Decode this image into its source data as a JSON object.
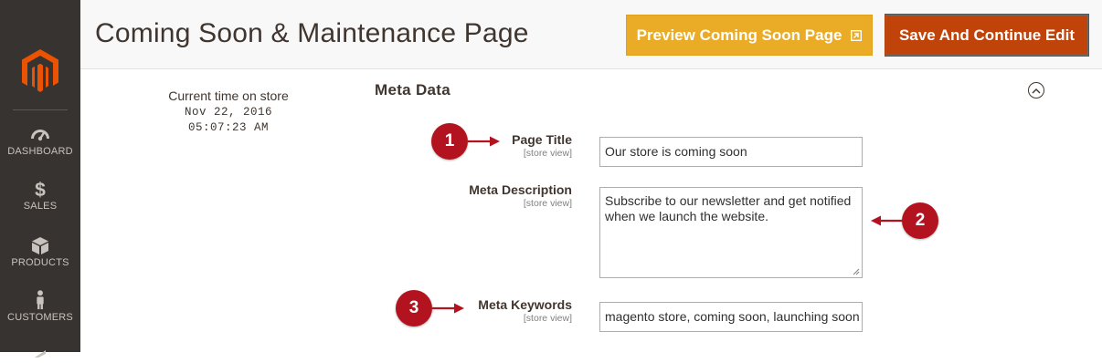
{
  "sidebar": {
    "items": [
      {
        "label": "DASHBOARD",
        "icon": "dashboard-icon"
      },
      {
        "label": "SALES",
        "icon": "dollar-icon"
      },
      {
        "label": "PRODUCTS",
        "icon": "box-icon"
      },
      {
        "label": "CUSTOMERS",
        "icon": "person-icon"
      }
    ],
    "colors": {
      "background": "#373330",
      "logo": "#eb5202",
      "text": "#c9c3bd"
    }
  },
  "header": {
    "title": "Coming Soon & Maintenance Page",
    "preview_button": "Preview Coming Soon Page",
    "save_button": "Save And Continue Edit",
    "colors": {
      "preview": "#eaac26",
      "save": "#c0440a"
    }
  },
  "store_time": {
    "label": "Current time on store",
    "date": "Nov 22, 2016",
    "time": "05:07:23 AM"
  },
  "section": {
    "title": "Meta Data",
    "fields": [
      {
        "label": "Page Title",
        "scope": "[store view]",
        "value": "Our store is coming soon"
      },
      {
        "label": "Meta Description",
        "scope": "[store view]",
        "value": "Subscribe to our newsletter and get notified when we launch the website."
      },
      {
        "label": "Meta Keywords",
        "scope": "[store view]",
        "value": "magento store, coming soon, launching soon"
      }
    ]
  },
  "markers": [
    "1",
    "2",
    "3"
  ],
  "marker_color": "#b3131f"
}
